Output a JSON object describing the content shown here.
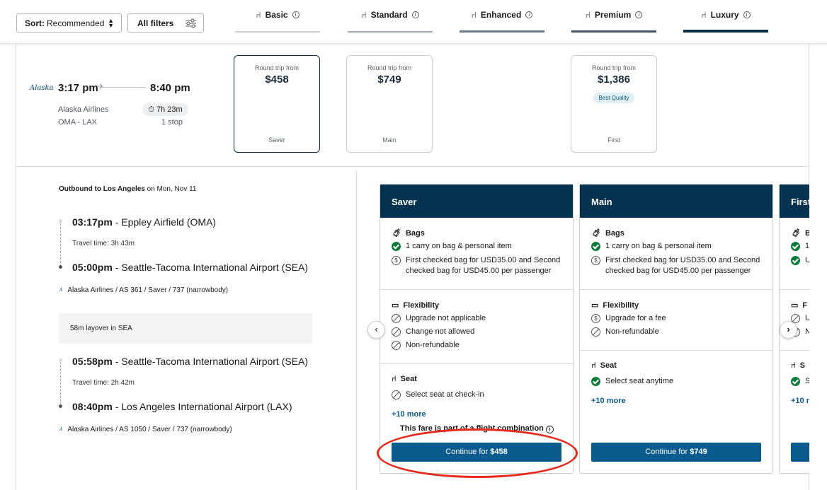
{
  "toolbar": {
    "sort_prefix": "Sort:",
    "sort_value": "Recommended",
    "filters_label": "All filters"
  },
  "tiers": [
    {
      "label": "Basic",
      "color": "#c9ced3"
    },
    {
      "label": "Standard",
      "color": "#9aa6b0"
    },
    {
      "label": "Enhanced",
      "color": "#6c7d8a"
    },
    {
      "label": "Premium",
      "color": "#3f5566"
    },
    {
      "label": "Luxury",
      "color": "#0a2e45"
    }
  ],
  "flight": {
    "logo": "Alaska",
    "depart_time": "3:17 pm",
    "arrive_time": "8:40 pm",
    "airline": "Alaska Airlines",
    "route": "OMA - LAX",
    "duration": "7h 23m",
    "stops": "1 stop"
  },
  "price_cards": [
    {
      "caption": "Round trip from",
      "price": "$458",
      "name": "Saver",
      "badge": ""
    },
    {
      "caption": "Round trip from",
      "price": "$749",
      "name": "Main",
      "badge": ""
    },
    {
      "caption": "Round trip from",
      "price": "$1,386",
      "name": "First",
      "badge": "Best Quality"
    }
  ],
  "itinerary": {
    "header_bold": "Outbound to Los Angeles",
    "header_rest": "on Mon, Nov 11",
    "seg1_dep_time": "03:17pm",
    "seg1_dep_place": " - Eppley Airfield (OMA)",
    "seg1_travel": "Travel time: 3h 43m",
    "seg1_arr_time": "05:00pm",
    "seg1_arr_place": " - Seattle-Tacoma International Airport (SEA)",
    "seg1_leg": "Alaska Airlines / AS 361 / Saver / 737 (narrowbody)",
    "layover": "58m layover in SEA",
    "seg2_dep_time": "05:58pm",
    "seg2_dep_place": " - Seattle-Tacoma International Airport (SEA)",
    "seg2_travel": "Travel time: 2h 42m",
    "seg2_arr_time": "08:40pm",
    "seg2_arr_place": " - Los Angeles International Airport (LAX)",
    "seg2_leg": "Alaska Airlines / AS 1050 / Saver / 737 (narrowbody)"
  },
  "fares": {
    "saver": {
      "title": "Saver",
      "bags_title": "Bags",
      "bags_1": "1 carry on bag & personal item",
      "bags_2": "First checked bag for USD35.00 and Second checked bag for USD45.00 per passenger",
      "flex_title": "Flexibility",
      "flex_1": "Upgrade not applicable",
      "flex_2": "Change not allowed",
      "flex_3": "Non-refundable",
      "seat_title": "Seat",
      "seat_1": "Select seat at check-in",
      "more": "+10 more",
      "note": "This fare is part of a flight combination",
      "btn_prefix": "Continue for ",
      "btn_price": "$458"
    },
    "main": {
      "title": "Main",
      "bags_title": "Bags",
      "bags_1": "1 carry on bag & personal item",
      "bags_2": "First checked bag for USD35.00 and Second checked bag for USD45.00 per passenger",
      "flex_title": "Flexibility",
      "flex_1": "Upgrade for a fee",
      "flex_2": "Non-refundable",
      "seat_title": "Seat",
      "seat_1": "Select seat anytime",
      "more": "+10 more",
      "btn_prefix": "Continue for ",
      "btn_price": "$749"
    },
    "first": {
      "title": "First",
      "bags_1": "1",
      "bags_2": "U",
      "flex_1": "U",
      "flex_2": "N",
      "seat_1": "S",
      "more": "+10 m"
    }
  }
}
